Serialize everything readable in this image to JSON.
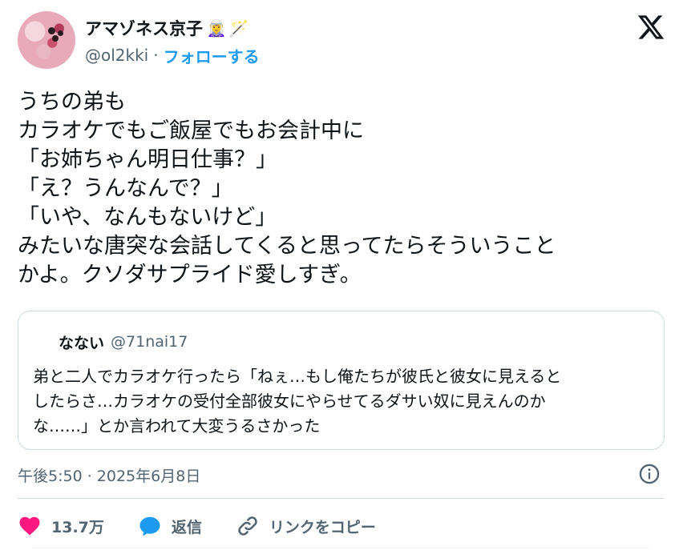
{
  "author": {
    "display_name": "アマゾネス京子",
    "emojis": [
      "🧝‍♀️",
      "🪄"
    ],
    "handle": "@ol2kki",
    "separator": "·",
    "follow_label": "フォローする"
  },
  "tweet": {
    "lines": [
      "うちの弟も",
      "カラオケでもご飯屋でもお会計中に",
      "「お姉ちゃん明日仕事？」",
      "「え？うんなんで？」",
      "「いや、なんもないけど」",
      "みたいな唐突な会話してくると思ってたらそういうこと",
      "かよ。クソダサプライド愛しすぎ。"
    ]
  },
  "quote": {
    "name": "なない",
    "handle": "@71nai17",
    "lines": [
      "弟と二人でカラオケ行ったら「ねぇ…もし俺たちが彼氏と彼女に見えると",
      "したらさ…カラオケの受付全部彼女にやらせてるダサい奴に見えんのか",
      "な……」とか言われて大変うるさかった"
    ]
  },
  "meta": {
    "timestamp": "午後5:50 · 2025年6月8日"
  },
  "actions": {
    "like_count": "13.7万",
    "reply_label": "返信",
    "copy_link_label": "リンクをコピー"
  },
  "colors": {
    "like": "#f91880",
    "reply": "#1d9bf0",
    "link": "#1d9bf0",
    "secondary_text": "#536471"
  }
}
